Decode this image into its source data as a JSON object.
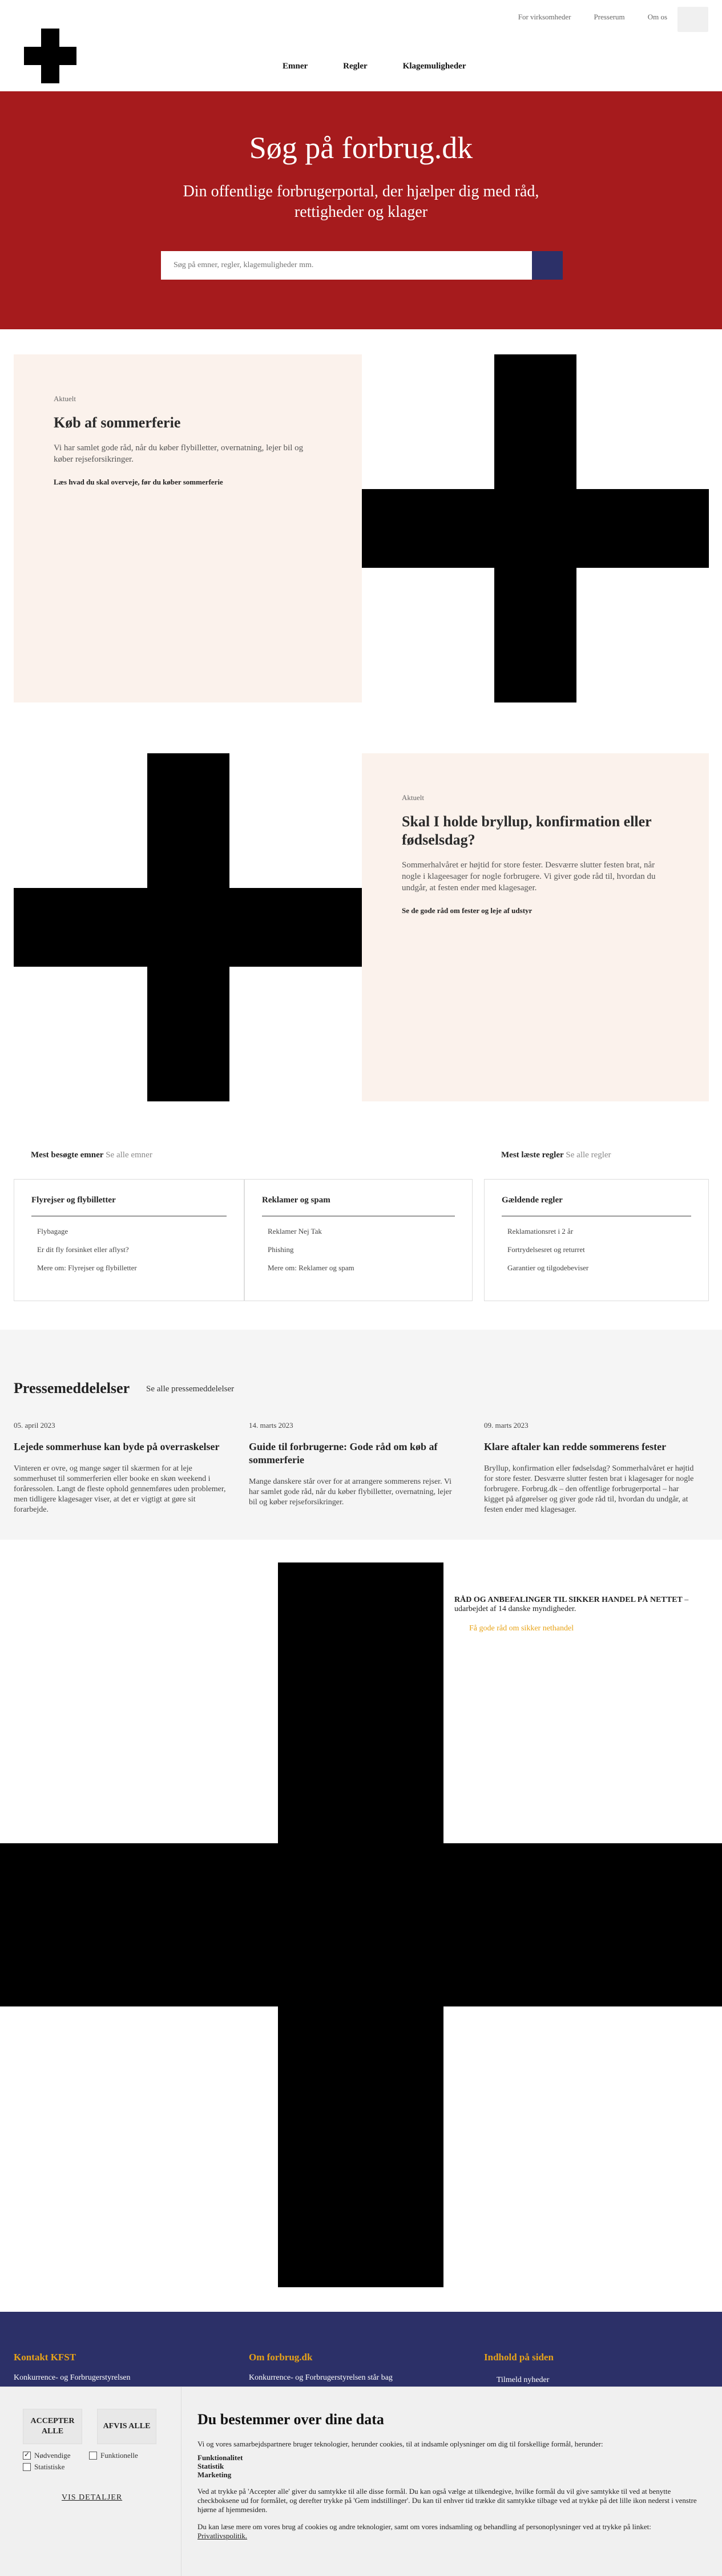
{
  "header": {
    "top_links": [
      "For virksomheder",
      "Presserum",
      "Om os"
    ],
    "nav": [
      "Emner",
      "Regler",
      "Klagemuligheder"
    ]
  },
  "hero": {
    "title": "Søg på forbrug.dk",
    "subtitle": "Din offentlige forbrugerportal, der hjælper dig med råd, rettigheder og klager",
    "search_placeholder": "Søg på emner, regler, klagemuligheder mm."
  },
  "feature1": {
    "kicker": "Aktuelt",
    "title": "Køb af sommerferie",
    "text": "Vi har samlet gode råd, når du køber flybilletter, overnatning, lejer bil og køber rejseforsikringer.",
    "cta": "Læs hvad du skal overveje, før du køber sommerferie"
  },
  "feature2": {
    "kicker": "Aktuelt",
    "title": "Skal I holde bryllup, konfirmation eller fødselsdag?",
    "text": "Sommerhalvåret er højtid for store fester. Desværre slutter festen brat, når nogle i klageesager for nogle forbrugere. Vi giver gode råd til, hvordan du undgår, at festen ender med klagesager.",
    "cta": "Se de gode råd om fester og leje af udstyr"
  },
  "most_visited": {
    "topics_label": "Mest besøgte emner",
    "topics_see": "Se alle emner",
    "rules_label": "Mest læste regler",
    "rules_see": "Se alle regler",
    "boxes": [
      {
        "title": "Flyrejser og flybilletter",
        "items": [
          "Flybagage",
          "Er dit fly forsinket eller aflyst?",
          "Mere om: Flyrejser og flybilletter"
        ]
      },
      {
        "title": "Reklamer og spam",
        "items": [
          "Reklamer Nej Tak",
          "Phishing",
          "Mere om: Reklamer og spam"
        ]
      },
      {
        "title": "Gældende regler",
        "items": [
          "Reklamationsret i 2 år",
          "Fortrydelsesret og returret",
          "Garantier og tilgodebeviser"
        ]
      }
    ]
  },
  "press": {
    "title": "Pressemeddelelser",
    "see_all": "Se alle pressemeddelelser",
    "items": [
      {
        "date": "05. april 2023",
        "title": "Lejede sommerhuse kan byde på overraskelser",
        "text": "Vinteren er ovre, og mange søger til skærmen for at leje sommerhuset til sommerferien eller booke en skøn weekend i foråressolen. Langt de fleste ophold gennemføres uden problemer, men tidligere klagesager viser, at det er vigtigt at gøre sit forarbejde."
      },
      {
        "date": "14. marts 2023",
        "title": "Guide til forbrugerne: Gode råd om køb af sommerferie",
        "text": "Mange danskere står over for at arrangere sommerens rejser. Vi har samlet gode råd, når du køber flybilletter, overnatning, lejer bil og køber rejseforsikringer."
      },
      {
        "date": "09. marts 2023",
        "title": "Klare aftaler kan redde sommerens fester",
        "text": "Bryllup, konfirmation eller fødselsdag? Sommerhalvåret er højtid for store fester. Desværre slutter festen brat i klagesager for nogle forbrugere. Forbrug.dk – den offentlige forbrugerportal – har kigget på afgørelser og giver gode råd til, hvordan du undgår, at festen ender med klagesager."
      }
    ]
  },
  "campaign": {
    "title_bold": "RÅD OG ANBEFALINGER TIL SIKKER HANDEL PÅ NETTET",
    "title_rest": "– udarbejdet af 14 danske myndigheder.",
    "link": "Få gode råd om sikker nethandel"
  },
  "footer": {
    "cols": [
      {
        "title": "Kontakt KFST",
        "text": "Konkurrence- og Forbrugerstyrelsen"
      },
      {
        "title": "Om forbrug.dk",
        "text": "Konkurrence- og Forbrugerstyrelsen står bag"
      },
      {
        "title": "Indhold på siden",
        "text": "Tilmeld nyheder"
      }
    ]
  },
  "cookie": {
    "accept": "ACCEPTER ALLE",
    "reject": "AFVIS ALLE",
    "checkboxes": [
      "Nødvendige",
      "Funktionelle",
      "Statistiske"
    ],
    "details": "VIS DETALJER",
    "title": "Du bestemmer over dine data",
    "intro": "Vi og vores samarbejdspartnere bruger teknologier, herunder cookies, til at indsamle oplysninger om dig til forskellige formål, herunder:",
    "categories": [
      "Funktionalitet",
      "Statistik",
      "Marketing"
    ],
    "body": "Ved at trykke på 'Accepter alle' giver du samtykke til alle disse formål. Du kan også vælge at tilkendegive, hvilke formål du vil give samtykke til ved at benytte checkboksene ud for formålet, og derefter trykke på 'Gem indstillinger'. Du kan til enhver tid trække dit samtykke tilbage ved at trykke på det lille ikon nederst i venstre hjørne af hjemmesiden.",
    "privacy_text": "Du kan læse mere om vores brug af cookies og andre teknologier, samt om vores indsamling og behandling af personoplysninger ved at trykke på linket:",
    "privacy_link": "Privatlivspolitik."
  }
}
